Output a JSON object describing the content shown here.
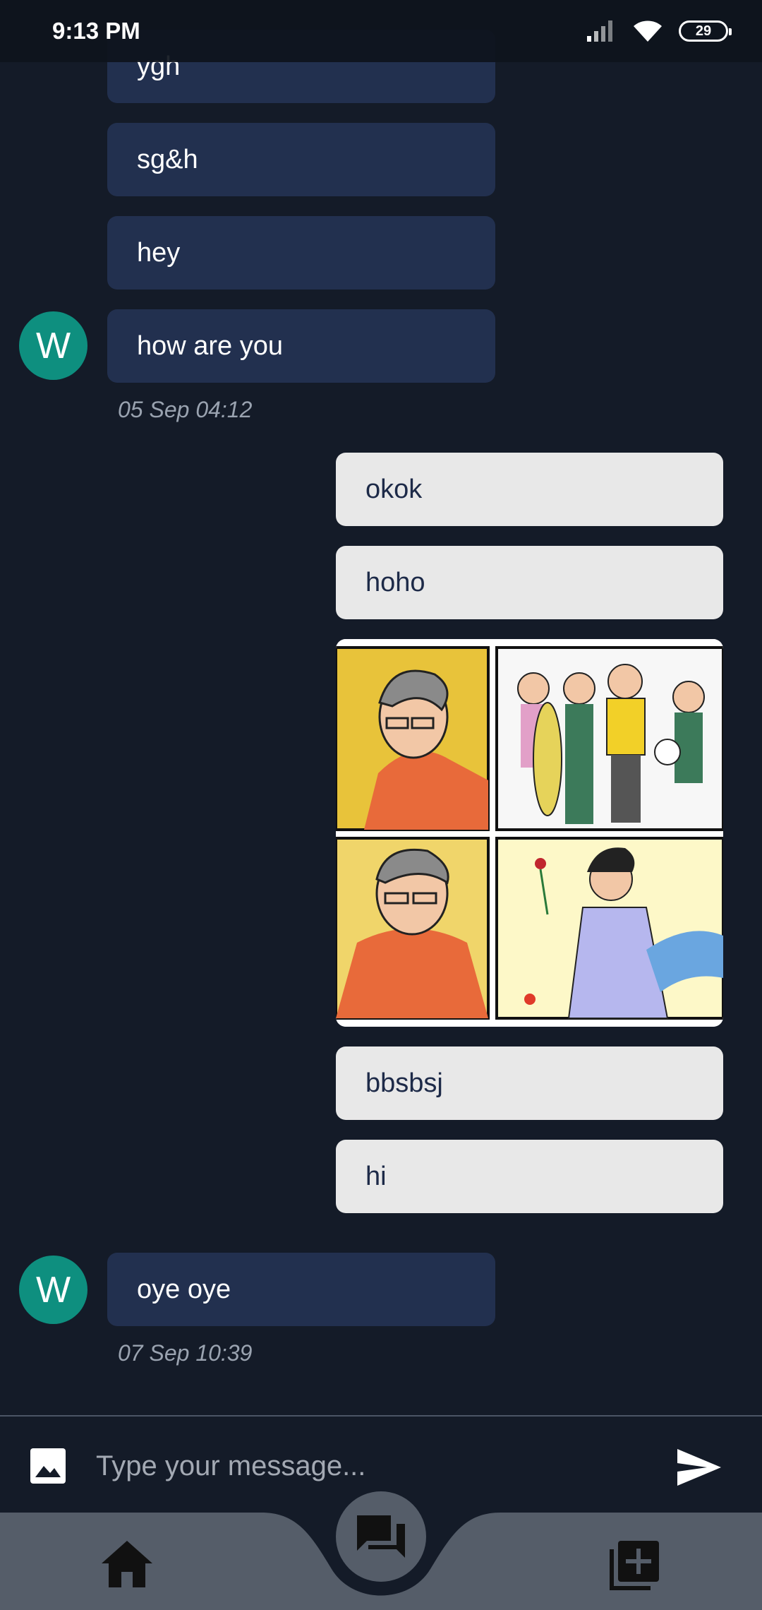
{
  "status_bar": {
    "time": "9:13 PM",
    "battery": "29"
  },
  "messages": [
    {
      "text": "ygh",
      "side": "in"
    },
    {
      "text": "sg&h",
      "side": "in"
    },
    {
      "text": "hey",
      "side": "in"
    },
    {
      "text": "how are you",
      "side": "in"
    },
    {
      "text": "okok",
      "side": "out"
    },
    {
      "text": "hoho",
      "side": "out"
    },
    {
      "text": "bbsbsj",
      "side": "out"
    },
    {
      "text": "hi",
      "side": "out"
    },
    {
      "text": "oye oye",
      "side": "in"
    }
  ],
  "avatars": [
    {
      "initial": "W"
    },
    {
      "initial": "W"
    }
  ],
  "timestamps": [
    "05 Sep 04:12",
    "07 Sep 10:39"
  ],
  "composer": {
    "placeholder": "Type your message...",
    "gallery_icon": "image-icon",
    "send_icon": "send-icon"
  },
  "bottom_nav": {
    "home_icon": "home-icon",
    "chat_icon": "forum-icon",
    "add_icon": "add-box-icon"
  },
  "colors": {
    "background": "#141b28",
    "incoming_bubble": "#22304f",
    "outgoing_bubble": "#e8e8e8",
    "avatar": "#0e8f7f",
    "nav": "#555d69"
  }
}
